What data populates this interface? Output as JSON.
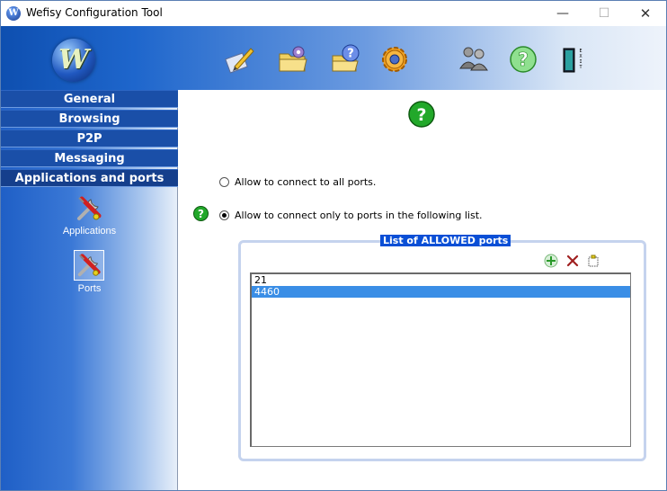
{
  "window": {
    "title": "Wefisy Configuration Tool",
    "app_icon_letter": "W",
    "min_glyph": "—",
    "max_glyph": "☐",
    "close_glyph": "✕"
  },
  "header": {
    "logo_letter": "W",
    "toolbar": [
      {
        "name": "edit-settings-icon"
      },
      {
        "name": "folder-settings-icon"
      },
      {
        "name": "folder-help-icon"
      },
      {
        "name": "gear-icon"
      },
      {
        "name": "users-icon"
      },
      {
        "name": "help-icon"
      },
      {
        "name": "exit-icon",
        "label": "EXIT"
      }
    ]
  },
  "nav": {
    "items": [
      "General",
      "Browsing",
      "P2P",
      "Messaging",
      "Applications and ports"
    ],
    "tools": [
      {
        "label": "Applications",
        "icon": "tools-icon"
      },
      {
        "label": "Ports",
        "icon": "tools-icon"
      }
    ]
  },
  "main": {
    "options": [
      {
        "label": "Allow to connect to all ports.",
        "checked": false
      },
      {
        "label": "Allow to connect only to ports in the following list.",
        "checked": true
      }
    ],
    "group_title": "List of ALLOWED ports",
    "ports": [
      {
        "value": "21",
        "selected": false
      },
      {
        "value": "4460",
        "selected": true
      }
    ]
  },
  "colors": {
    "nav_bar": "#1a4fa8",
    "selection": "#3a8ee6",
    "group_title_bg": "#0a4fd6",
    "help_green": "#22a82a"
  }
}
